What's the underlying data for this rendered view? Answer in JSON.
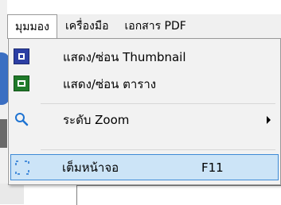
{
  "menubar": {
    "items": [
      {
        "label": "มุมมอง",
        "active": true
      },
      {
        "label": "เครื่องมือ"
      },
      {
        "label": "เอกสาร PDF"
      }
    ]
  },
  "dropdown": {
    "items": [
      {
        "label": "แสดง/ซ่อน Thumbnail",
        "icon": "thumbnail-icon"
      },
      {
        "label": "แสดง/ซ่อน ตาราง",
        "icon": "table-icon"
      },
      {
        "label": "ระดับ Zoom",
        "icon": "magnifier-icon",
        "has_submenu": true
      },
      {
        "label": "เต็มหน้าจอ",
        "shortcut": "F11",
        "icon": "fullscreen-icon",
        "highlighted": true
      }
    ]
  },
  "colors": {
    "highlight_bg": "#cce4f7",
    "highlight_border": "#3e8ad6",
    "thumbnail_icon": "#2c3fa4",
    "table_icon": "#1f7a2a",
    "zoom_icon": "#1e73d2"
  }
}
